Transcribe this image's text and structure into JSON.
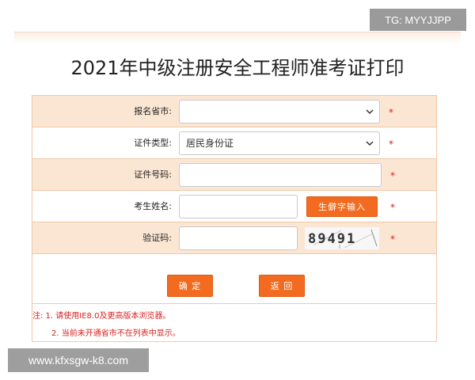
{
  "badge": "TG: MYYJJPP",
  "title": "2021年中级注册安全工程师准考证打印",
  "form": {
    "province": {
      "label": "报名省市:",
      "value": ""
    },
    "id_type": {
      "label": "证件类型:",
      "value": "居民身份证"
    },
    "id_number": {
      "label": "证件号码:",
      "value": ""
    },
    "name": {
      "label": "考生姓名:",
      "value": "",
      "rare_char_button": "生僻字输入"
    },
    "captcha": {
      "label": "验证码:",
      "value": "",
      "image_text": "89491"
    },
    "required_mark": "*"
  },
  "actions": {
    "confirm": "确 定",
    "back": "返 回"
  },
  "notes": {
    "line1": "注: 1. 请使用IE8.0及更高版本浏览器。",
    "line2": "2. 当前未开通省市不在列表中显示。"
  },
  "watermark": "www.kfxsgw-k8.com",
  "colors": {
    "accent": "#f26b21",
    "row_bg": "#fbe6d3",
    "border": "#f0c8a8",
    "required": "#d9201f"
  }
}
